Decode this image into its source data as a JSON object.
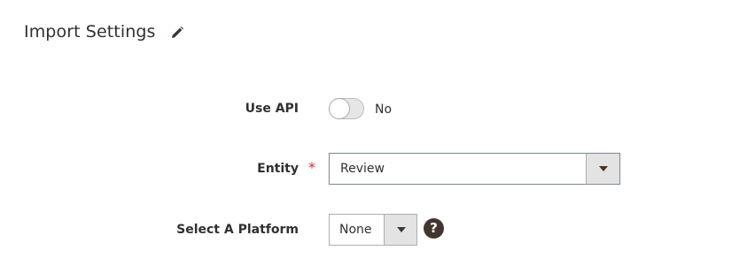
{
  "section": {
    "title": "Import Settings",
    "edit_icon": "pencil-icon"
  },
  "form": {
    "use_api": {
      "label": "Use API",
      "state": "No"
    },
    "entity": {
      "label": "Entity",
      "required_mark": "*",
      "selected": "Review"
    },
    "platform": {
      "label": "Select A Platform",
      "selected": "None",
      "help_icon": "?"
    }
  },
  "colors": {
    "text": "#303030",
    "required": "#e22626",
    "icon_dark": "#41362f",
    "select_border": "#7d8e9b",
    "arrow_bg": "#e3e3e3"
  }
}
